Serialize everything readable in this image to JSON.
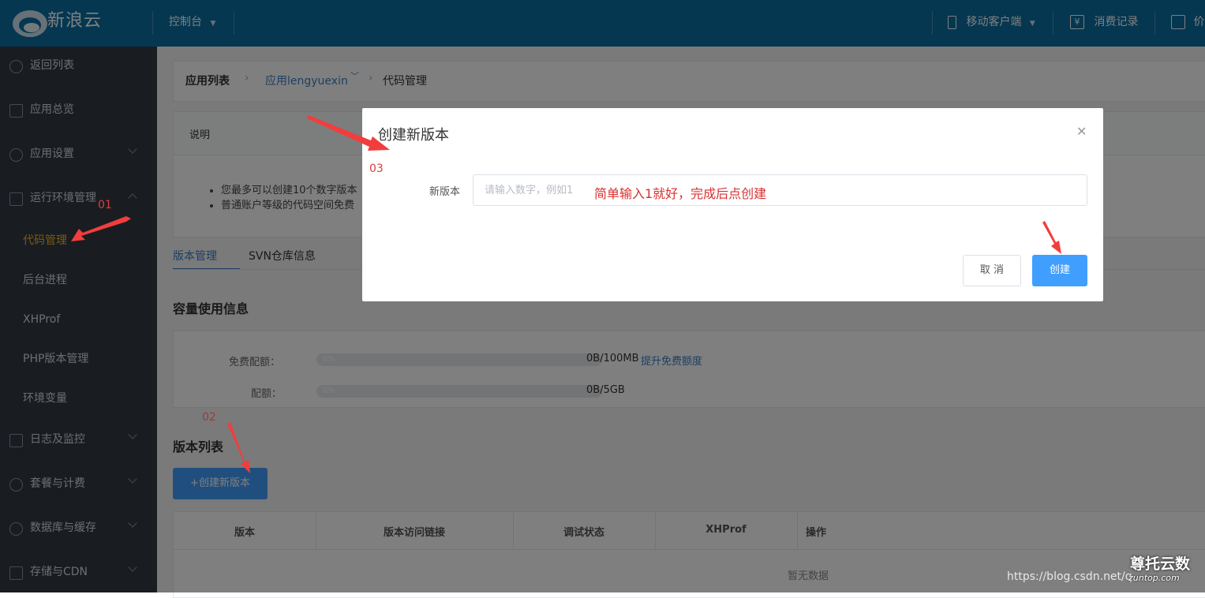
{
  "topbar": {
    "logo_text": "新浪云",
    "console": "控制台",
    "mobile": "移动客户端",
    "billing": "消费记录",
    "price": "价"
  },
  "sidebar": {
    "items": [
      {
        "label": "返回列表",
        "icon": "back-icon"
      },
      {
        "label": "应用总览",
        "icon": "home-icon"
      },
      {
        "label": "应用设置",
        "icon": "gear-icon"
      },
      {
        "label": "运行环境管理",
        "icon": "runtime-icon"
      }
    ],
    "sub_items": [
      {
        "label": "代码管理"
      },
      {
        "label": "后台进程"
      },
      {
        "label": "XHProf"
      },
      {
        "label": "PHP版本管理"
      },
      {
        "label": "环境变量"
      }
    ],
    "more_items": [
      {
        "label": "日志及监控",
        "icon": "log-icon"
      },
      {
        "label": "套餐与计费",
        "icon": "yen-icon"
      },
      {
        "label": "数据库与缓存",
        "icon": "database-icon"
      },
      {
        "label": "存储与CDN",
        "icon": "storage-icon"
      }
    ]
  },
  "breadcrumb": {
    "root": "应用列表",
    "app": "应用lengyuexin",
    "current": "代码管理"
  },
  "notice": {
    "title": "说明",
    "lines": [
      "您最多可以创建10个数字版本",
      "普通账户等级的代码空间免费"
    ]
  },
  "tabs": [
    "版本管理",
    "SVN仓库信息"
  ],
  "capacity": {
    "title": "容量使用信息",
    "free_label": "免费配额：",
    "free_value": "0B/100MB",
    "free_link": "提升免费额度",
    "free_pct": "0%",
    "quota_label": "配额：",
    "quota_value": "0B/5GB",
    "quota_pct": "0%"
  },
  "versions": {
    "title": "版本列表",
    "create_button": "+创建新版本",
    "columns": [
      "版本",
      "版本访问链接",
      "调试状态",
      "XHProf",
      "操作"
    ],
    "empty": "暂无数据"
  },
  "modal": {
    "title": "创建新版本",
    "field_label": "新版本",
    "placeholder": "请输入数字，例如1",
    "cancel": "取 消",
    "create": "创建"
  },
  "annotations": {
    "n01": "01",
    "n02": "02",
    "n03": "03",
    "hint": "简单输入1就好，完成后点创建",
    "color": "#e23b3b"
  },
  "watermark": {
    "url": "https://blog.csdn.net/q",
    "brand": "尊托云数",
    "brand_sub": "zuntop.com"
  }
}
